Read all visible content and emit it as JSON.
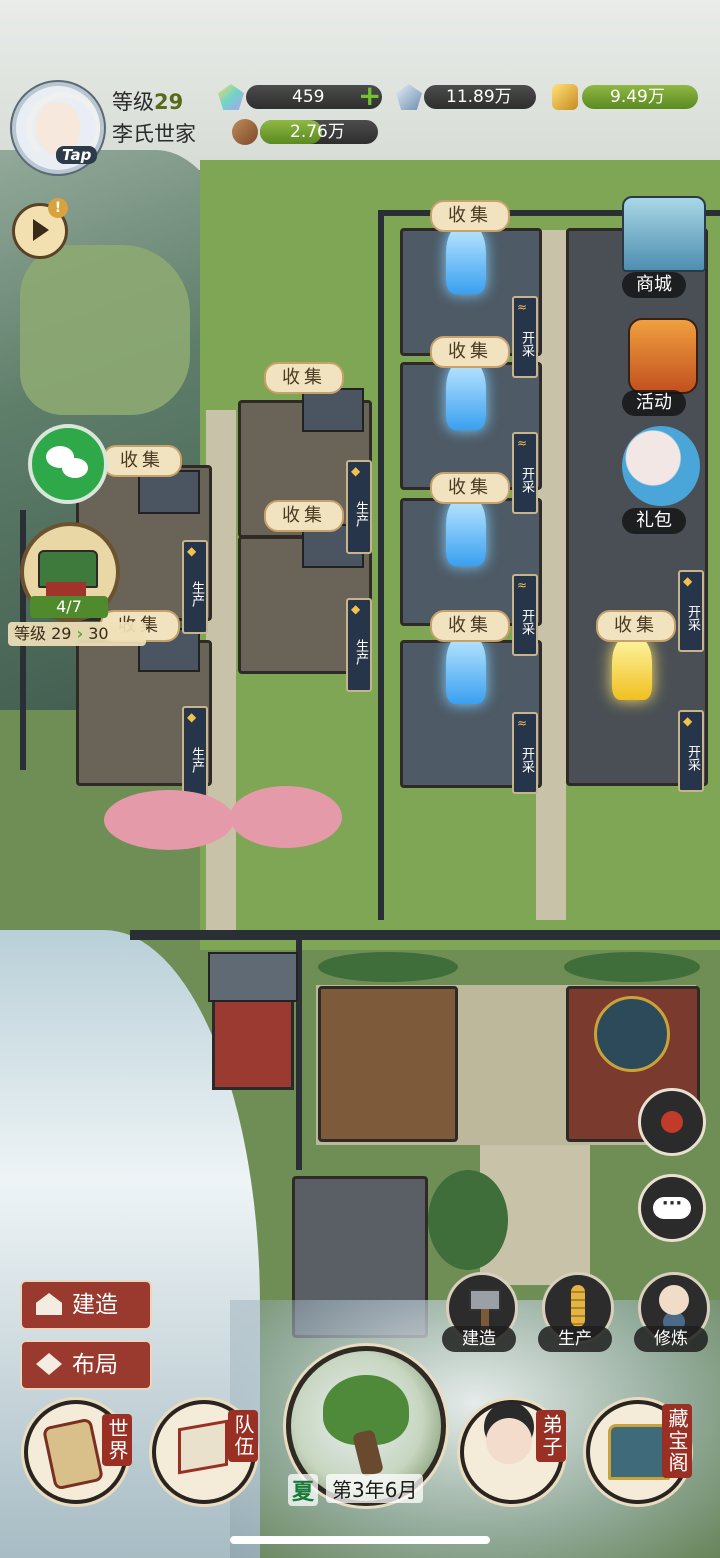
{
  "player": {
    "level_label": "等级",
    "level": "29",
    "clan_name": "李氏世家",
    "tap_badge": "Tap"
  },
  "resources": {
    "spirit_stone": "459",
    "crystal": "11.89万",
    "gold": "9.49万",
    "wood": "2.76万"
  },
  "sect": {
    "count": "4/7",
    "level_label": "等级",
    "level_from": "29",
    "level_to": "30"
  },
  "right_menu": {
    "shop": "商城",
    "event": "活动",
    "gift": "礼包"
  },
  "map": {
    "collect": "收集",
    "produce": "生产",
    "mine": "开采"
  },
  "actions": {
    "build": "建造",
    "layout": "布局"
  },
  "quick": {
    "build": "建造",
    "produce": "生产",
    "cultivate": "修炼"
  },
  "nav": {
    "world": "世界",
    "team": "队伍",
    "disciple": "弟子",
    "treasury": "藏宝阁"
  },
  "season": {
    "name": "夏",
    "date": "第3年6月"
  },
  "colors": {
    "accent_red": "#9a3a2f",
    "resource_green": "#5b8a20",
    "crystal_blue": "#3aa0f0",
    "gold_crystal": "#f0c020"
  }
}
